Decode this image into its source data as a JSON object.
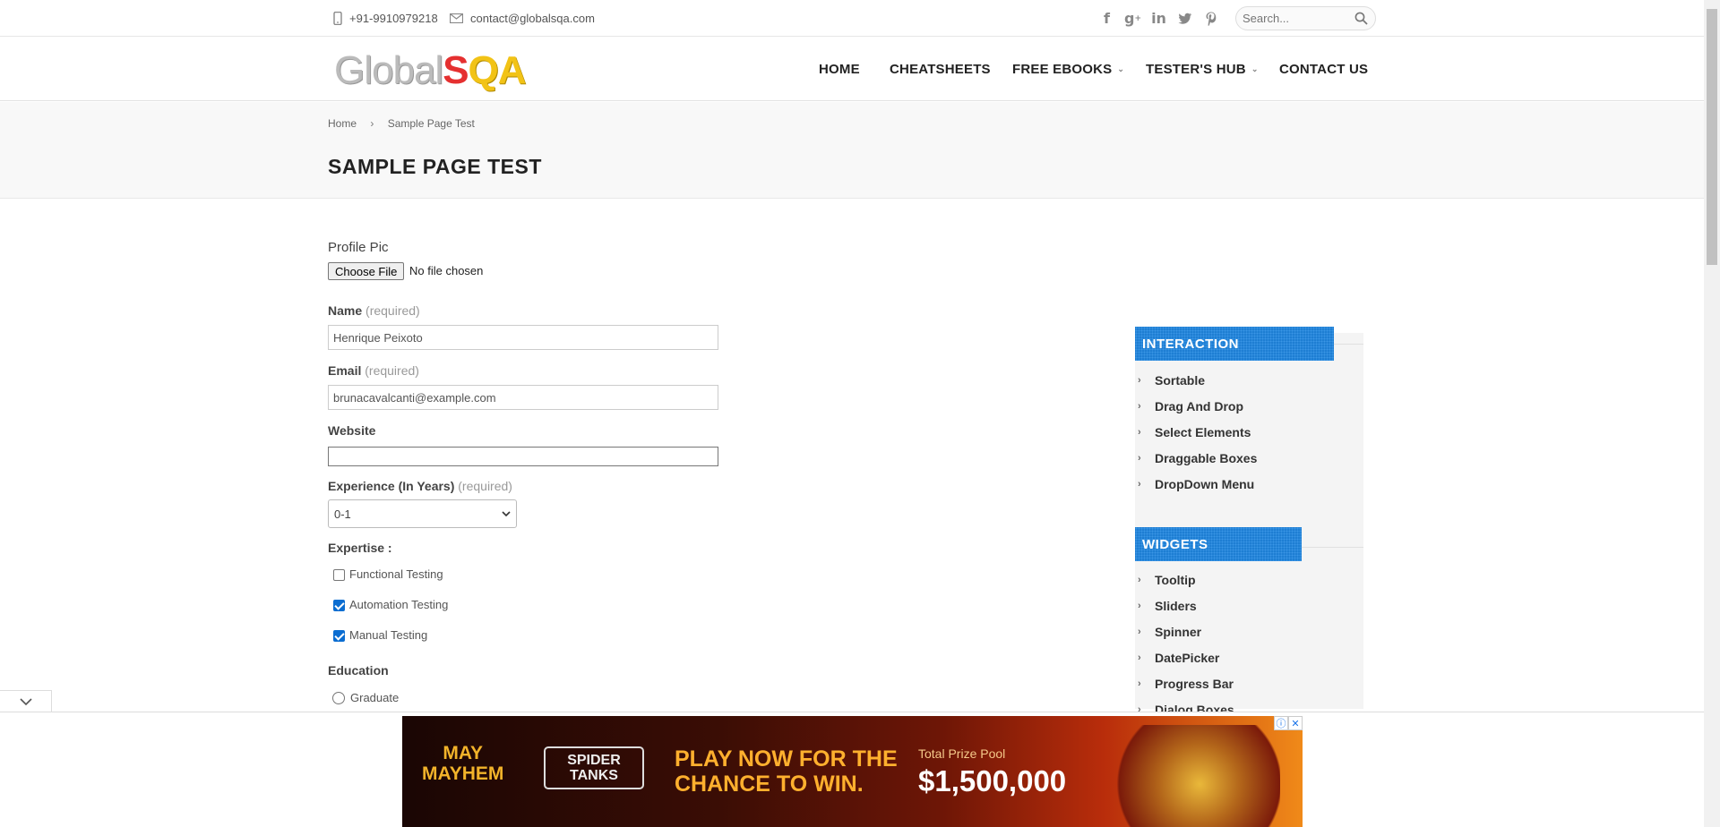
{
  "topbar": {
    "phone": "+91-9910979218",
    "email": "contact@globalsqa.com",
    "social": [
      "facebook-icon",
      "google-plus-icon",
      "linkedin-icon",
      "twitter-icon",
      "pinterest-icon"
    ],
    "search_placeholder": "Search..."
  },
  "header": {
    "logo_part1": "Global",
    "logo_part2": "S",
    "logo_part3": "QA",
    "nav": [
      {
        "label": "HOME",
        "dropdown": false
      },
      {
        "label": "CHEATSHEETS",
        "dropdown": false
      },
      {
        "label": "FREE EBOOKS",
        "dropdown": true
      },
      {
        "label": "TESTER'S HUB",
        "dropdown": true
      },
      {
        "label": "CONTACT US",
        "dropdown": false
      }
    ]
  },
  "breadcrumb": {
    "home": "Home",
    "current": "Sample Page Test"
  },
  "page_title": "SAMPLE PAGE TEST",
  "form": {
    "profile_pic_label": "Profile Pic",
    "choose_file": "Choose File",
    "no_file": "No file chosen",
    "name_label": "Name",
    "required": "(required)",
    "name_value": "Henrique Peixoto",
    "email_label": "Email",
    "email_value": "brunacavalcanti@example.com",
    "website_label": "Website",
    "website_value": "",
    "experience_label": "Experience (In Years)",
    "experience_value": "0-1",
    "expertise_label": "Expertise :",
    "expertise": [
      {
        "label": "Functional Testing",
        "checked": false
      },
      {
        "label": "Automation Testing",
        "checked": true
      },
      {
        "label": "Manual Testing",
        "checked": true
      }
    ],
    "education_label": "Education",
    "education_option": "Graduate"
  },
  "sidebar": {
    "interaction_title": "INTERACTION",
    "interaction_items": [
      "Sortable",
      "Drag And Drop",
      "Select Elements",
      "Draggable Boxes",
      "DropDown Menu"
    ],
    "widgets_title": "WIDGETS",
    "widgets_items": [
      "Tooltip",
      "Sliders",
      "Spinner",
      "DatePicker",
      "Progress Bar",
      "Dialog Boxes"
    ]
  },
  "ad": {
    "may": "MAY",
    "mayhem": "MAYHEM",
    "brand": "SPIDER TANKS",
    "headline1": "PLAY NOW FOR THE",
    "headline2": "CHANCE TO WIN.",
    "pool_label": "Total Prize Pool",
    "pool_value": "$1,500,000",
    "info": "ⓘ",
    "close": "✕"
  },
  "colors": {
    "accent": "#1e7ed3",
    "logo_red": "#e53030",
    "logo_yellow": "#f2c316",
    "checkbox": "#0b6dd1"
  }
}
